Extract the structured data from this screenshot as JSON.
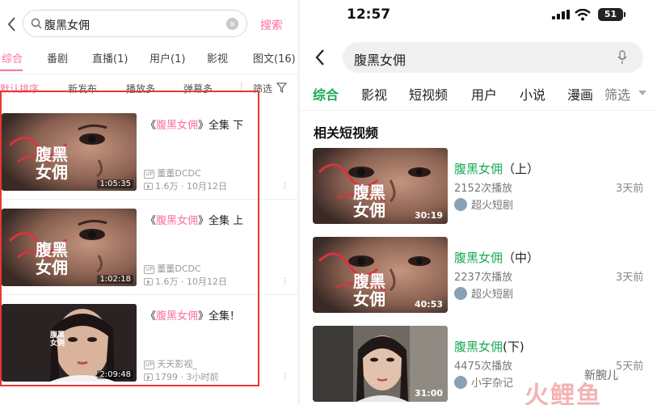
{
  "left": {
    "search_query": "腹黑女佣",
    "search_button": "搜索",
    "clear_glyph": "×",
    "tabs": [
      "综合",
      "番剧",
      "直播(1)",
      "用户(1)",
      "影视",
      "图文(16)"
    ],
    "sort": [
      "默认排序",
      "新发布",
      "播放多",
      "弹幕多"
    ],
    "filter_label": "筛选",
    "results": [
      {
        "title_pre": "《",
        "title_hl": "腹黑女佣",
        "title_post": "》全集  下",
        "duration": "1:05:35",
        "uploader": "董董DCDC",
        "views": "1.6万",
        "date": "10月12日",
        "thumb_text": "腹黑\n女佣"
      },
      {
        "title_pre": "《",
        "title_hl": "腹黑女佣",
        "title_post": "》全集  上",
        "duration": "1:02:18",
        "uploader": "董董DCDC",
        "views": "1.6万",
        "date": "10月12日",
        "thumb_text": "腹黑\n女佣"
      },
      {
        "title_pre": "《",
        "title_hl": "腹黑女佣",
        "title_post": "》全集！",
        "duration": "2:09:48",
        "uploader": "天天影视_",
        "views": "1799",
        "date": "3小时前",
        "thumb_text": "腹黑\n女佣"
      }
    ],
    "up_badge": "UP",
    "meta_sep": "·",
    "accent_color": "#fb7299",
    "highlight_box_color": "#e53935"
  },
  "right": {
    "status_time": "12:57",
    "battery": "51",
    "search_query": "腹黑女佣",
    "tabs": [
      "综合",
      "影视",
      "短视频",
      "用户",
      "小说",
      "漫画",
      "筛选"
    ],
    "section_title": "相关短视频",
    "videos": [
      {
        "title_hl": "腹黑女佣",
        "title_post": "（上）",
        "plays": "2152次播放",
        "author": "超火短剧",
        "ago": "3天前",
        "duration": "30:19"
      },
      {
        "title_hl": "腹黑女佣",
        "title_post": "（中）",
        "plays": "2237次播放",
        "author": "超火短剧",
        "ago": "3天前",
        "duration": "40:53"
      },
      {
        "title_hl": "腹黑女佣",
        "title_post": "(下)",
        "plays": "4475次播放",
        "author": "小宇杂记",
        "ago": "5天前",
        "duration": "31:00"
      }
    ],
    "accent_color": "#1aaa55"
  },
  "watermark": {
    "line1": "新腕儿",
    "line2": "火鲤鱼"
  }
}
